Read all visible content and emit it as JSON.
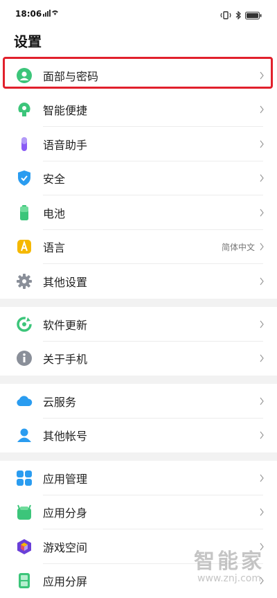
{
  "status": {
    "time": "18:06"
  },
  "page_title": "设置",
  "groups": [
    {
      "items": [
        {
          "label": "面部与密码",
          "icon": "face-icon",
          "value": ""
        },
        {
          "label": "智能便捷",
          "icon": "smart-assist-icon",
          "value": ""
        },
        {
          "label": "语音助手",
          "icon": "microphone-icon",
          "value": ""
        },
        {
          "label": "安全",
          "icon": "shield-icon",
          "value": ""
        },
        {
          "label": "电池",
          "icon": "battery-icon",
          "value": ""
        },
        {
          "label": "语言",
          "icon": "language-icon",
          "value": "简体中文"
        },
        {
          "label": "其他设置",
          "icon": "gear-icon",
          "value": ""
        }
      ]
    },
    {
      "items": [
        {
          "label": "软件更新",
          "icon": "update-icon",
          "value": ""
        },
        {
          "label": "关于手机",
          "icon": "info-icon",
          "value": ""
        }
      ]
    },
    {
      "items": [
        {
          "label": "云服务",
          "icon": "cloud-icon",
          "value": ""
        },
        {
          "label": "其他帐号",
          "icon": "account-icon",
          "value": ""
        }
      ]
    },
    {
      "items": [
        {
          "label": "应用管理",
          "icon": "app-grid-icon",
          "value": ""
        },
        {
          "label": "应用分身",
          "icon": "app-clone-icon",
          "value": ""
        },
        {
          "label": "游戏空间",
          "icon": "game-space-icon",
          "value": ""
        },
        {
          "label": "应用分屏",
          "icon": "split-screen-icon",
          "value": ""
        }
      ]
    }
  ],
  "watermark": {
    "title": "智能家",
    "url": "www.znj.com"
  },
  "colors": {
    "highlight": "#e1202c",
    "icon_green": "#3cc57a",
    "icon_blue": "#2a9cf0",
    "icon_purple": "#8a5cf5",
    "icon_gray": "#8a8f99"
  }
}
